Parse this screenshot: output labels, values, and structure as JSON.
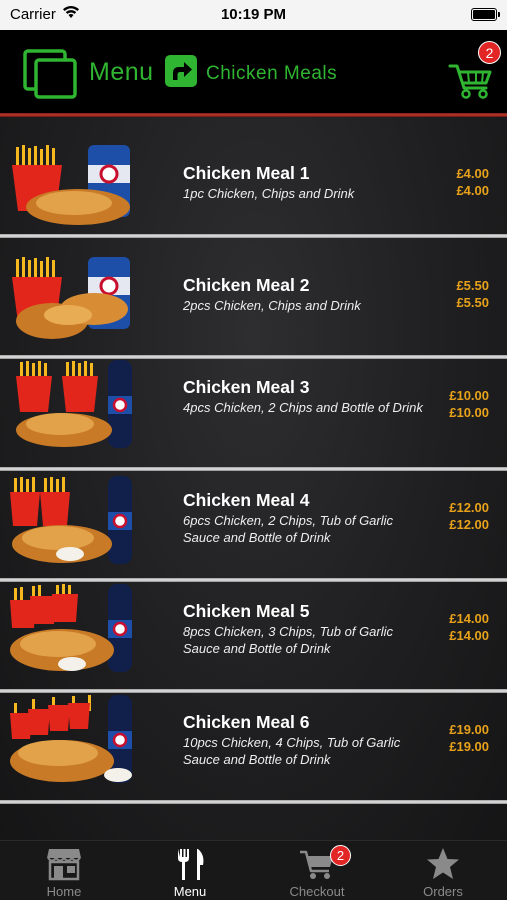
{
  "status_bar": {
    "carrier": "Carrier",
    "time": "10:19 PM"
  },
  "header": {
    "menu_label": "Menu",
    "breadcrumb": "Chicken Meals",
    "cart_count": "2",
    "accent_color": "#2fb531"
  },
  "meals": [
    {
      "name": "Chicken Meal 1",
      "description": "1pc Chicken, Chips and Drink",
      "price": "£4.00",
      "price_total": "£4.00"
    },
    {
      "name": "Chicken Meal 2",
      "description": "2pcs Chicken, Chips and Drink",
      "price": "£5.50",
      "price_total": "£5.50"
    },
    {
      "name": "Chicken Meal 3",
      "description": "4pcs Chicken, 2 Chips and Bottle of Drink",
      "price": "£10.00",
      "price_total": "£10.00"
    },
    {
      "name": "Chicken Meal 4",
      "description": "6pcs Chicken, 2 Chips, Tub of Garlic Sauce and Bottle of Drink",
      "price": "£12.00",
      "price_total": "£12.00"
    },
    {
      "name": "Chicken Meal 5",
      "description": "8pcs Chicken, 3 Chips, Tub of Garlic Sauce and Bottle of Drink",
      "price": "£14.00",
      "price_total": "£14.00"
    },
    {
      "name": "Chicken Meal 6",
      "description": "10pcs Chicken, 4 Chips, Tub of Garlic Sauce and Bottle of Drink",
      "price": "£19.00",
      "price_total": "£19.00"
    }
  ],
  "tabs": [
    {
      "label": "Home",
      "icon": "store-icon"
    },
    {
      "label": "Menu",
      "icon": "fork-knife-icon",
      "active": true
    },
    {
      "label": "Checkout",
      "icon": "cart-icon",
      "badge": "2"
    },
    {
      "label": "Orders",
      "icon": "star-icon"
    }
  ],
  "price_color": "#e8a21a"
}
